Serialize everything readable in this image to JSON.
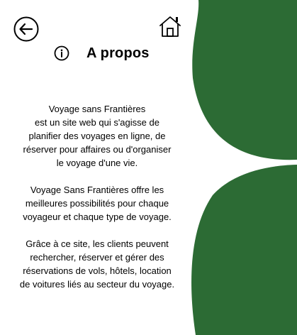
{
  "header": {
    "title": "A propos",
    "back_icon": "arrow-left-circle-icon",
    "home_icon": "home-icon",
    "info_icon": "info-circle-icon"
  },
  "about": {
    "paragraphs": [
      "Voyage sans Frantières\nest un site web qui s'agisse de\nplanifier des voyages en ligne, de\nréserver pour affaires ou d'organiser\nle voyage d'une vie.",
      "Voyage Sans Frantières offre les\nmeilleures possibilités pour chaque\nvoyageur et chaque type de voyage.",
      "Grâce à ce site, les clients peuvent\nrechercher, réserver et gérer des\nréservations de vols, hôtels,  location\nde voitures liés au secteur du voyage."
    ]
  },
  "theme": {
    "accent": "#2c6b34",
    "text": "#000000",
    "background": "#ffffff"
  }
}
